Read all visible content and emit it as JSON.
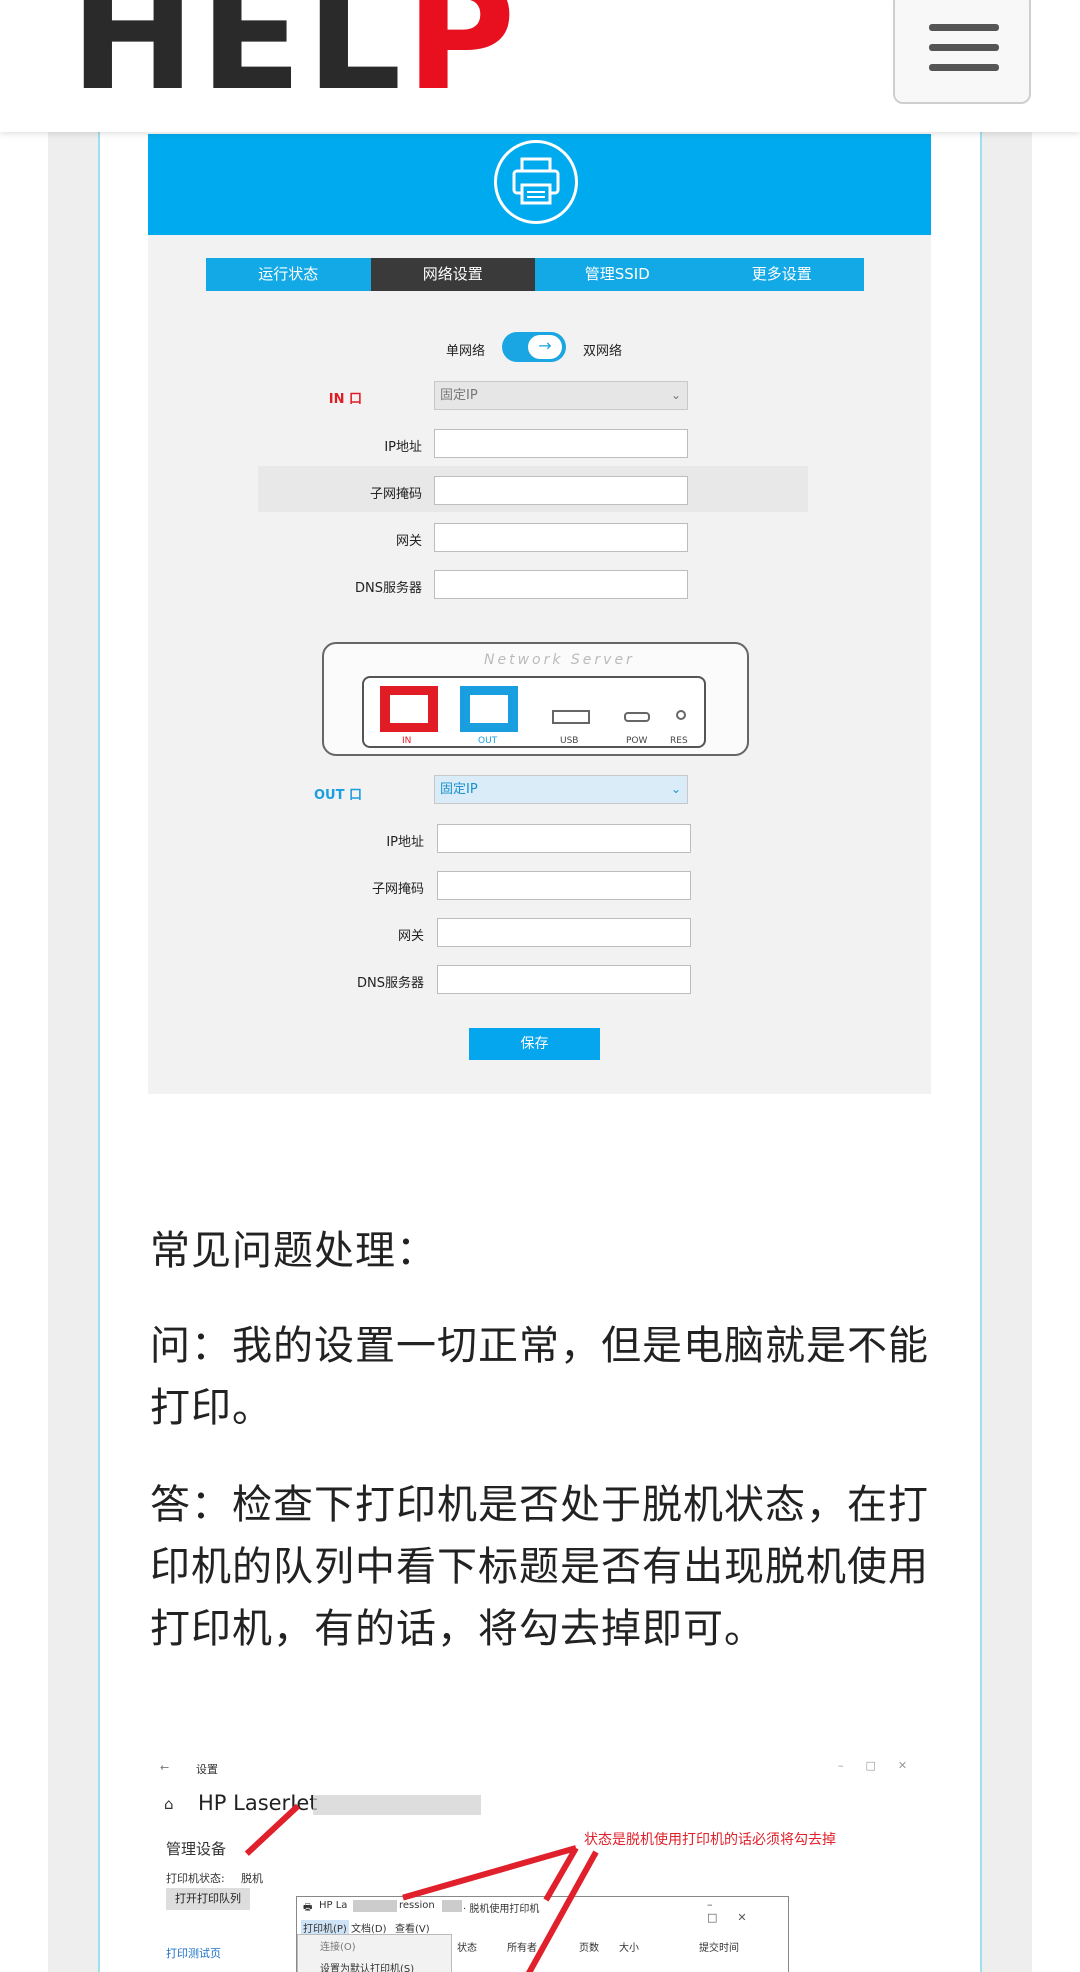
{
  "header": {
    "logo_part1": "HEL",
    "logo_part2": "P",
    "menu_icon": "hamburger-menu-icon"
  },
  "shot1": {
    "tabs": [
      {
        "label": "运行状态"
      },
      {
        "label": "网络设置",
        "active": true
      },
      {
        "label": "管理SSID"
      },
      {
        "label": "更多设置"
      }
    ],
    "toggle": {
      "left": "单网络",
      "right": "双网络",
      "arrow": "→"
    },
    "in_port": {
      "label": "IN 口",
      "mode": "固定IP",
      "fields": [
        {
          "label": "IP地址",
          "value": ""
        },
        {
          "label": "子网掩码",
          "value": ""
        },
        {
          "label": "网关",
          "value": ""
        },
        {
          "label": "DNS服务器",
          "value": ""
        }
      ]
    },
    "device": {
      "title": "Network Server",
      "ports": [
        "IN",
        "OUT",
        "USB",
        "POW",
        "RES"
      ]
    },
    "out_port": {
      "label": "OUT 口",
      "mode": "固定IP",
      "fields": [
        {
          "label": "IP地址",
          "value": ""
        },
        {
          "label": "子网掩码",
          "value": ""
        },
        {
          "label": "网关",
          "value": ""
        },
        {
          "label": "DNS服务器",
          "value": ""
        }
      ]
    },
    "save_label": "保存"
  },
  "article": {
    "heading": "常见问题处理：",
    "question": "问：我的设置一切正常，但是电脑就是不能打印。",
    "answer": "答：检查下打印机是否处于脱机状态，在打印机的队列中看下标题是否有出现脱机使用打印机，有的话，将勾去掉即可。"
  },
  "shot2": {
    "settings_title": "设置",
    "device_name": "HP LaserJet",
    "section": "管理设备",
    "status_label": "打印机状态:",
    "status_value": "脱机",
    "open_queue": "打开打印队列",
    "print_test": "打印测试页",
    "annotation": "状态是脱机使用打印机的话必须将勾去掉",
    "queue_window": {
      "title_prefix": "HP La",
      "title_mid": "ression",
      "title_suffix": "· 脱机使用打印机",
      "menus": [
        "打印机(P)",
        "文档(D)",
        "查看(V)"
      ],
      "menu_items": [
        "连接(O)",
        "设置为默认打印机(S)"
      ],
      "columns": [
        "状态",
        "所有者",
        "页数",
        "大小",
        "提交时间"
      ]
    }
  }
}
